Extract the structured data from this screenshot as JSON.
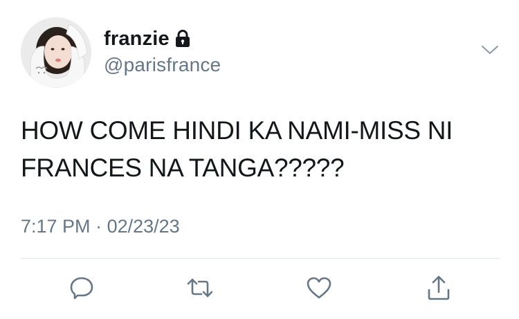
{
  "user": {
    "display_name": "franzie",
    "handle": "@parisfrance",
    "protected_icon": "lock-icon",
    "avatar_icon": "profile-photo"
  },
  "tweet": {
    "text": "HOW COME HINDI KA NAMI-MISS NI\nFRANCES NA TANGA?????",
    "time": "7:17 PM",
    "separator": "·",
    "date": "02/23/23"
  },
  "menu": {
    "icon": "chevron-down-icon"
  },
  "actions": [
    {
      "icon": "reply-icon"
    },
    {
      "icon": "retweet-icon"
    },
    {
      "icon": "like-icon"
    },
    {
      "icon": "share-icon"
    }
  ],
  "colors": {
    "text": "#14171a",
    "secondary": "#657786",
    "divider": "#e1e8ed",
    "background": "#ffffff"
  }
}
